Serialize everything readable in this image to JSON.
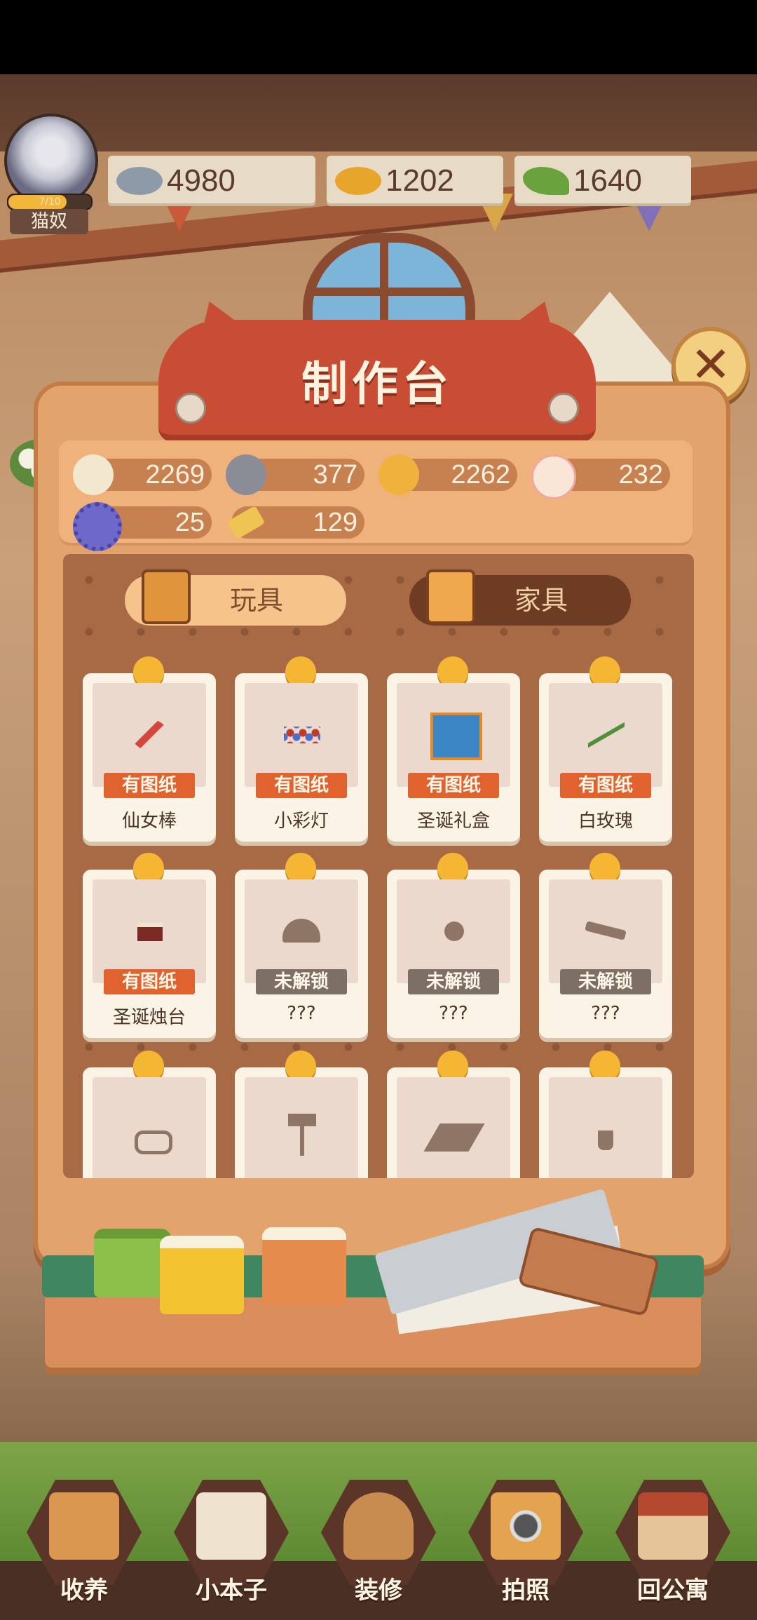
{
  "player": {
    "level": "7/10",
    "level_progress": 0.7,
    "title": "猫奴"
  },
  "resources": [
    {
      "icon": "gray-fish-icon",
      "value": "4980"
    },
    {
      "icon": "gold-fish-icon",
      "value": "1202"
    },
    {
      "icon": "green-grass-icon",
      "value": "1640"
    }
  ],
  "panel": {
    "title": "制作台"
  },
  "materials": [
    {
      "icon": "white-ball-icon",
      "value": "2269"
    },
    {
      "icon": "gray-stone-icon",
      "value": "377"
    },
    {
      "icon": "gold-ball-icon",
      "value": "2262"
    },
    {
      "icon": "paw-icon",
      "value": "232"
    },
    {
      "icon": "gear-icon",
      "value": "25"
    },
    {
      "icon": "gold-bar-icon",
      "value": "129"
    }
  ],
  "tabs": [
    {
      "label": "玩具",
      "active": true
    },
    {
      "label": "家具",
      "active": false
    }
  ],
  "items": [
    {
      "icon": "fairy-wand-icon",
      "badge": "有图纸",
      "name": "仙女棒",
      "locked": false
    },
    {
      "icon": "string-lights-icon",
      "badge": "有图纸",
      "name": "小彩灯",
      "locked": false
    },
    {
      "icon": "gift-box-icon",
      "badge": "有图纸",
      "name": "圣诞礼盒",
      "locked": false
    },
    {
      "icon": "white-rose-icon",
      "badge": "有图纸",
      "name": "白玫瑰",
      "locked": false
    },
    {
      "icon": "candle-holder-icon",
      "badge": "有图纸",
      "name": "圣诞烛台",
      "locked": false
    },
    {
      "icon": "locked-item-icon",
      "badge": "未解锁",
      "name": "???",
      "locked": true
    },
    {
      "icon": "locked-item-icon",
      "badge": "未解锁",
      "name": "???",
      "locked": true
    },
    {
      "icon": "locked-item-icon",
      "badge": "未解锁",
      "name": "???",
      "locked": true
    },
    {
      "icon": "snorkel-icon",
      "badge": "",
      "name": "",
      "locked": true
    },
    {
      "icon": "palm-tree-icon",
      "badge": "",
      "name": "",
      "locked": true
    },
    {
      "icon": "beach-chair-icon",
      "badge": "",
      "name": "",
      "locked": true
    },
    {
      "icon": "drink-icon",
      "badge": "",
      "name": "",
      "locked": true
    }
  ],
  "nav": [
    {
      "icon": "adopt-box-icon",
      "label": "收养"
    },
    {
      "icon": "notebook-icon",
      "label": "小本子"
    },
    {
      "icon": "decorate-bucket-icon",
      "label": "装修"
    },
    {
      "icon": "camera-icon",
      "label": "拍照"
    },
    {
      "icon": "apartment-icon",
      "label": "回公寓"
    }
  ],
  "colors": {
    "accent": "#c94d35",
    "badge_has": "#e0632f",
    "badge_locked": "#7d6f66",
    "pin": "#f4b633"
  }
}
